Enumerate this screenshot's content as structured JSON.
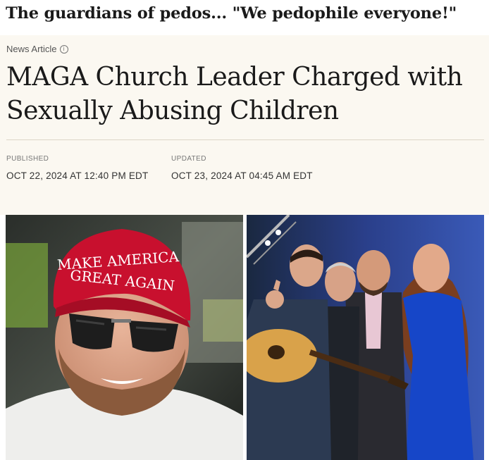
{
  "caption": "The guardians of pedos... \"We pedophile everyone!\"",
  "article": {
    "category": "News Article",
    "info_icon": "info-icon",
    "headline_line1": "MAGA Church Leader Charged with",
    "headline_line2": "Sexually Abusing Children",
    "published_label": "PUBLISHED",
    "published_value": "OCT 22, 2024 AT 12:40 PM EDT",
    "updated_label": "UPDATED",
    "updated_value": "OCT 23, 2024 AT 04:45 AM EDT"
  },
  "photos": {
    "left": {
      "hat_line1": "MAKE AMERICA",
      "hat_line2": "GREAT AGAIN"
    }
  }
}
